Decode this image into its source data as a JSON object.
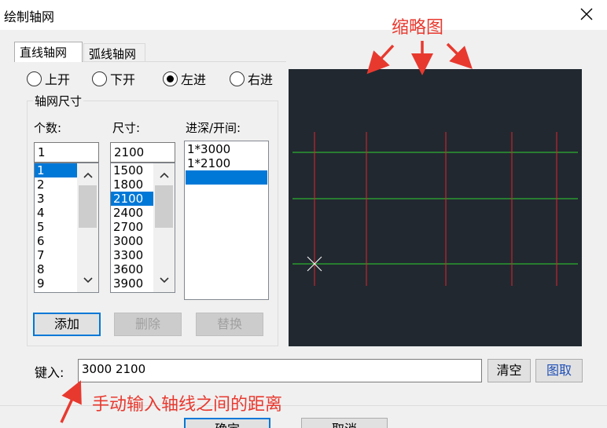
{
  "window": {
    "title": "绘制轴网"
  },
  "tabs": [
    {
      "label": "直线轴网"
    },
    {
      "label": "弧线轴网"
    }
  ],
  "radios": [
    {
      "label": "上开",
      "checked": false
    },
    {
      "label": "下开",
      "checked": false
    },
    {
      "label": "左进",
      "checked": true
    },
    {
      "label": "右进",
      "checked": false
    }
  ],
  "group": {
    "label": "轴网尺寸"
  },
  "count": {
    "label": "个数:",
    "value": "1",
    "items": [
      "1",
      "2",
      "3",
      "4",
      "5",
      "6",
      "7",
      "8",
      "9"
    ],
    "selected": "1"
  },
  "size": {
    "label": "尺寸:",
    "value": "2100",
    "items": [
      "1500",
      "1800",
      "2100",
      "2400",
      "2700",
      "3000",
      "3300",
      "3600",
      "3900"
    ],
    "selected": "2100"
  },
  "depth": {
    "label": "进深/开间:",
    "items": [
      "1*3000",
      "1*2100"
    ]
  },
  "actions": {
    "add": "添加",
    "delete": "删除",
    "replace": "替换"
  },
  "input": {
    "label": "键入:",
    "value": "3000 2100",
    "clear": "清空",
    "pick": "图取"
  },
  "footer": {
    "ok": "确定",
    "cancel": "取消"
  },
  "annotations": {
    "thumbnail": "缩略图",
    "manual": "手动输入轴线之间的距离"
  },
  "colors": {
    "preview_bg": "#212830",
    "axis_v": "#e0252b",
    "axis_h": "#2fd12f",
    "annotation": "#e8392f",
    "selection": "#0078d7"
  }
}
